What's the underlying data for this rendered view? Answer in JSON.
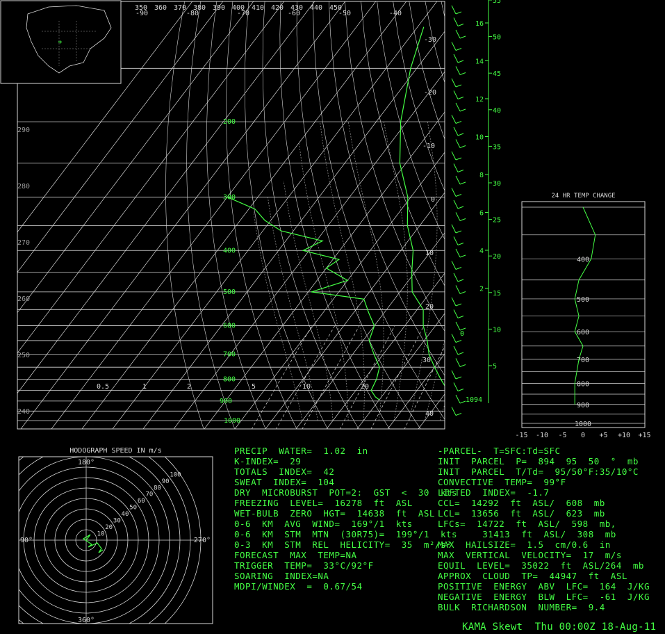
{
  "colors": {
    "background": "#000000",
    "sounding": "#44ff44",
    "grid": "#d8d8d8",
    "dim": "#9a9a9a"
  },
  "title": "KAMA Skewt  Thu 00:00Z 18-Aug-11",
  "top_labels": {
    "theta_e": [
      "350",
      "360",
      "370",
      "380",
      "390",
      "400",
      "410",
      "420",
      "430",
      "440",
      "450"
    ],
    "temps_c": [
      "-90",
      "-80",
      "-70",
      "-60",
      "-50",
      "-40"
    ]
  },
  "left_labels": [
    "290",
    "280",
    "270",
    "260",
    "250",
    "240"
  ],
  "mixing_ratio_labels": [
    "0.5",
    "1",
    "2",
    "5",
    "10",
    "20"
  ],
  "isotherm_labels": [
    "-30",
    "-20",
    "-10",
    "0",
    "10",
    "20",
    "30",
    "40"
  ],
  "height_km": [
    "16",
    "14",
    "12",
    "10",
    "8",
    "6",
    "4",
    "2"
  ],
  "height_kft": [
    "55",
    "50",
    "45",
    "40",
    "35",
    "30",
    "25",
    "20",
    "15",
    "10",
    "5"
  ],
  "station_elevation": "1094",
  "zero_label": "0",
  "inset_24hr": {
    "title": "24 HR TEMP CHANGE",
    "x_ticks": [
      "-15",
      "-10",
      "-5",
      "0",
      "+5",
      "+10",
      "+15"
    ],
    "p_labels": [
      "400",
      "500",
      "600",
      "700",
      "800",
      "900",
      "1000"
    ]
  },
  "hodograph": {
    "title": "HODOGRAPH SPEED IN m/s",
    "ring_labels": [
      "10",
      "20",
      "30",
      "40",
      "50",
      "60",
      "70",
      "80",
      "90",
      "100"
    ],
    "dir_top": "180°",
    "dir_left": "90°",
    "dir_right": "270°",
    "dir_bottom": "360°"
  },
  "indices_left": [
    "PRECIP  WATER=  1.02  in",
    "K-INDEX=  29",
    "TOTALS  INDEX=  42",
    "SWEAT  INDEX=  104",
    "DRY  MICROBURST  POT=2:  GST  <  30  kts",
    "FREEZING  LEVEL=  16278  ft  ASL",
    "WET-BULB  ZERO  HGT=  14638  ft  ASL",
    "0-6  KM  AVG  WIND=  169°/1  kts",
    "0-6  KM  STM  MTN  (30R75)=  199°/1  kts",
    "0-3  KM  STM  REL  HELICITY=  35  m²/s²",
    "FORECAST  MAX  TEMP=NA",
    "TRIGGER  TEMP=  33°C/92°F",
    "SOARING  INDEX=NA",
    "MDPI/WINDEX  =  0.67/54"
  ],
  "indices_right": [
    "-PARCEL-  T=SFC:Td=SFC",
    "INIT  PARCEL  P=  894  95  50  °  mb",
    "INIT  PARCEL  T/Td=  95/50°F:35/10°C",
    "CONVECTIVE  TEMP=  99°F",
    "LIFTED  INDEX=  -1.7",
    "CCL=  14292  ft  ASL/  608  mb",
    "LCL=  13656  ft  ASL/  623  mb",
    "LFCs=  14722  ft  ASL/  598  mb,",
    "        31413  ft  ASL/  308  mb",
    "MAX  HAILSIZE=  1.5  cm/0.6  in",
    "MAX  VERTICAL  VELOCITY=  17  m/s",
    "EQUIL  LEVEL=  35022  ft  ASL/264  mb",
    "APPROX  CLOUD  TP=  44947  ft  ASL",
    "POSITIVE  ENERGY  ABV  LFC=  164  J/KG",
    "NEGATIVE  ENERGY  BLW  LFC=  -61  J/KG",
    "BULK  RICHARDSON  NUMBER=  9.4"
  ],
  "chart_data": {
    "type": "line",
    "pressure_levels_mb": [
      1000,
      900,
      800,
      700,
      600,
      500,
      400,
      300,
      200
    ],
    "temperature_profile": {
      "p": [
        894,
        850,
        800,
        750,
        700,
        650,
        600,
        550,
        500,
        450,
        400,
        350,
        300,
        250,
        200,
        150,
        120
      ],
      "t": [
        35,
        30,
        25,
        20,
        15,
        11,
        6,
        2,
        -6,
        -11,
        -16,
        -24,
        -31,
        -42,
        -52,
        -62,
        -68
      ]
    },
    "dewpoint_profile": {
      "p": [
        894,
        880,
        850,
        800,
        750,
        700,
        650,
        600,
        560,
        520,
        500,
        470,
        440,
        420,
        400,
        380,
        360,
        340,
        320,
        300
      ],
      "td": [
        10,
        8,
        5,
        4,
        2,
        -3,
        -8,
        -10,
        -15,
        -20,
        -39,
        -30,
        -40,
        -38,
        -52,
        -48,
        -64,
        -72,
        -78,
        -90
      ]
    },
    "inset_24hr_change": {
      "p": [
        300,
        350,
        400,
        450,
        500,
        550,
        600,
        650,
        700,
        800,
        900
      ],
      "dt": [
        0,
        3,
        2,
        -1,
        -2,
        -1,
        -2,
        0,
        -1,
        -2,
        -2
      ]
    },
    "hodograph_speed_ms": [
      1,
      2,
      3,
      4,
      5
    ],
    "xlabel": "",
    "ylabel": ""
  }
}
